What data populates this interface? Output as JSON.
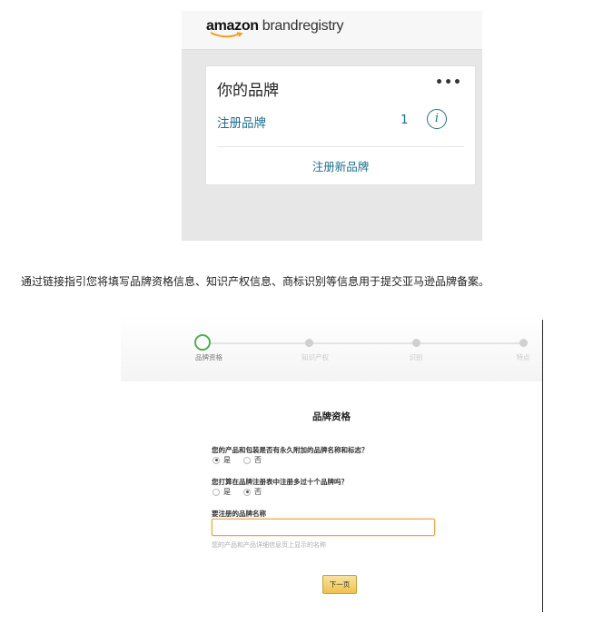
{
  "brand_registry": {
    "logo": {
      "amazon": "amazon",
      "rest": "brandregistry"
    },
    "card": {
      "title": "你的品牌",
      "menu": "•••",
      "registered_label": "注册品牌",
      "registered_count": "1",
      "info_icon": "i",
      "register_new": "注册新品牌"
    }
  },
  "caption": "通过链接指引您将填写品牌资格信息、知识产权信息、商标识别等信息用于提交亚马逊品牌备案。",
  "form": {
    "steps": [
      {
        "label": "品牌资格",
        "active": true
      },
      {
        "label": "知识产权",
        "active": false
      },
      {
        "label": "识别",
        "active": false
      },
      {
        "label": "特点",
        "active": false
      }
    ],
    "title": "品牌资格",
    "q1": {
      "text": "您的产品和包装是否有永久附加的品牌名称和标志？",
      "yes": "是",
      "no": "否",
      "selected": "yes"
    },
    "q2": {
      "text": "您打算在品牌注册表中注册多过十个品牌吗？",
      "yes": "是",
      "no": "否",
      "selected": "no"
    },
    "brand_name_label": "要注册的品牌名称",
    "brand_name_value": "",
    "brand_name_hint": "您的产品和产品详细信息页上显示的名称",
    "next_button": "下一页"
  },
  "colors": {
    "link": "#1a6f8a",
    "active_step": "#4caf50",
    "input_focus": "#e8a74b",
    "button": "#f0c14b"
  }
}
